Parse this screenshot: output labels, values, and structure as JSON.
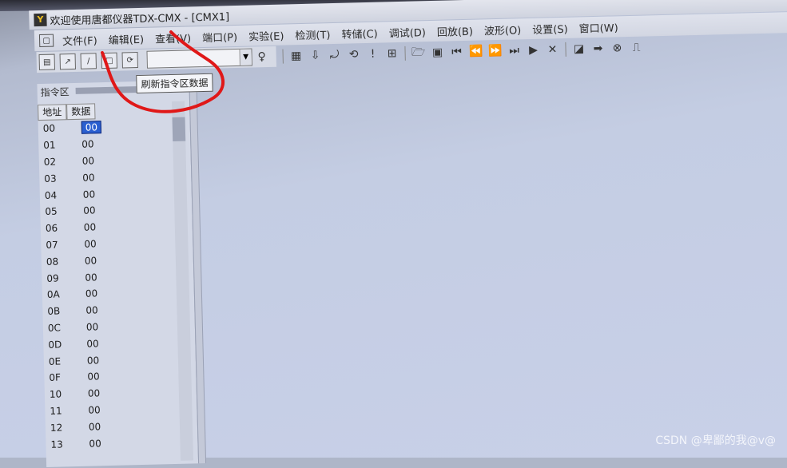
{
  "window": {
    "title": "欢迎使用唐都仪器TDX-CMX - [CMX1]"
  },
  "menubar": {
    "items": [
      "文件(F)",
      "编辑(E)",
      "查看(V)",
      "端口(P)",
      "实验(E)",
      "检测(T)",
      "转储(C)",
      "调试(D)",
      "回放(B)",
      "波形(O)",
      "设置(S)",
      "窗口(W)"
    ]
  },
  "toolbar": {
    "icons": [
      "grid-icon",
      "download-icon",
      "step-icon",
      "loop-icon",
      "exclamation-icon",
      "counter-icon",
      "open-folder-icon",
      "save-icon",
      "first-icon",
      "rewind-icon",
      "fast-forward-icon",
      "last-icon",
      "play-icon",
      "reset-icon",
      "waveform-icon",
      "arrow-right-icon",
      "stop-icon",
      "pulse-icon"
    ]
  },
  "tooltip": {
    "text": "刷新指令区数据"
  },
  "panel": {
    "title": "指令区",
    "col_addr": "地址",
    "col_data": "数据",
    "rows": [
      {
        "addr": "00",
        "data": "00"
      },
      {
        "addr": "01",
        "data": "00"
      },
      {
        "addr": "02",
        "data": "00"
      },
      {
        "addr": "03",
        "data": "00"
      },
      {
        "addr": "04",
        "data": "00"
      },
      {
        "addr": "05",
        "data": "00"
      },
      {
        "addr": "06",
        "data": "00"
      },
      {
        "addr": "07",
        "data": "00"
      },
      {
        "addr": "08",
        "data": "00"
      },
      {
        "addr": "09",
        "data": "00"
      },
      {
        "addr": "0A",
        "data": "00"
      },
      {
        "addr": "0B",
        "data": "00"
      },
      {
        "addr": "0C",
        "data": "00"
      },
      {
        "addr": "0D",
        "data": "00"
      },
      {
        "addr": "0E",
        "data": "00"
      },
      {
        "addr": "0F",
        "data": "00"
      },
      {
        "addr": "10",
        "data": "00"
      },
      {
        "addr": "11",
        "data": "00"
      },
      {
        "addr": "12",
        "data": "00"
      },
      {
        "addr": "13",
        "data": "00"
      }
    ]
  },
  "watermark": "CSDN @卑鄙的我@v@",
  "colors": {
    "selection": "#2a5fd0",
    "annotation": "#e01818"
  }
}
